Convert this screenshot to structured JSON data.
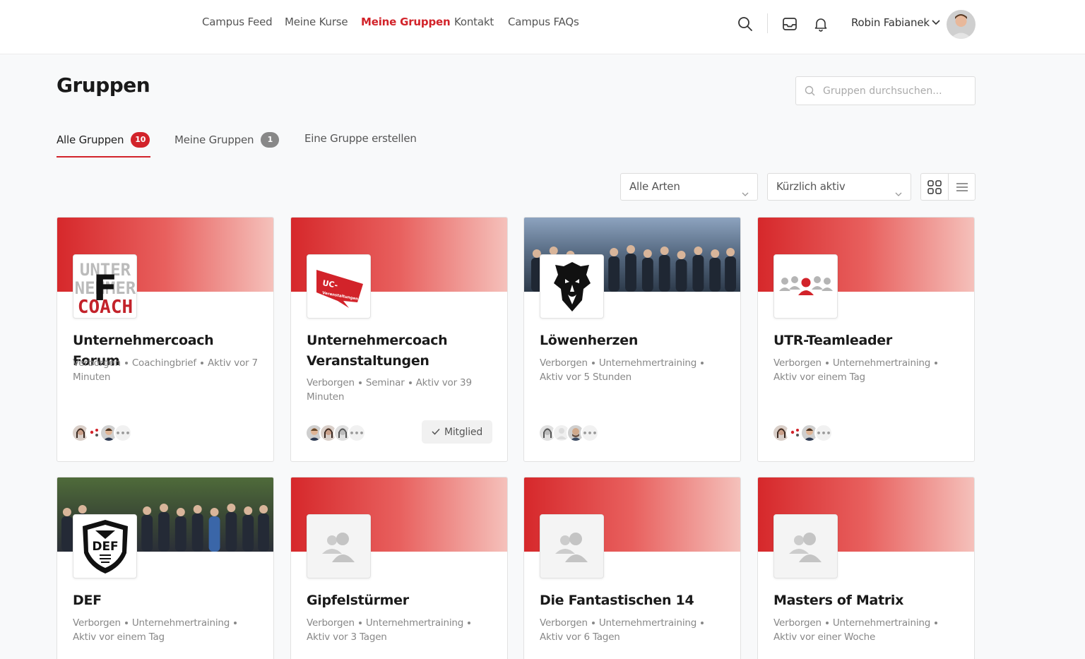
{
  "nav": {
    "items": [
      {
        "label": "Campus Feed"
      },
      {
        "label": "Meine Kurse"
      },
      {
        "label": "Meine Gruppen"
      },
      {
        "label": "Kontakt"
      },
      {
        "label": "Campus FAQs"
      }
    ],
    "active_index": 2
  },
  "user": {
    "name": "Robin Fabianek"
  },
  "page": {
    "title": "Gruppen"
  },
  "search": {
    "placeholder": "Gruppen durchsuchen..."
  },
  "tabs": [
    {
      "label": "Alle Gruppen",
      "count": "10",
      "badge_color": "#d2232a"
    },
    {
      "label": "Meine Gruppen",
      "count": "1",
      "badge_color": "#888888"
    },
    {
      "label": "Eine Gruppe erstellen"
    }
  ],
  "filters": {
    "type": "Alle Arten",
    "sort": "Kürzlich aktiv"
  },
  "accent_color": "#d2232a",
  "groups": [
    {
      "name": "Unternehmercoach Forum",
      "visibility": "Verborgen",
      "type": "Coachingbrief",
      "activity": "Aktiv vor 7 Minuten",
      "cover": "gradient",
      "logo": "unternehmer-coach-forum-logo",
      "logo_text": "UNTER NEHMER COACH F"
    },
    {
      "name": "Unternehmercoach Veranstaltungen",
      "visibility": "Verborgen",
      "type": "Seminar",
      "activity": "Aktiv vor 39 Minuten",
      "cover": "gradient",
      "logo": "uc-veranstaltungen-logo",
      "logo_text": "UC- Veranstaltungen",
      "member_label": "Mitglied"
    },
    {
      "name": "Löwenherzen",
      "visibility": "Verborgen",
      "type": "Unternehmertraining",
      "activity": "Aktiv vor 5 Stunden",
      "cover": "photo",
      "logo": "lion-logo"
    },
    {
      "name": "UTR-Teamleader",
      "visibility": "Verborgen",
      "type": "Unternehmertraining",
      "activity": "Aktiv vor einem Tag",
      "cover": "gradient",
      "logo": "team-group-icon"
    },
    {
      "name": "DEF",
      "visibility": "Verborgen",
      "type": "Unternehmertraining",
      "activity": "Aktiv vor einem Tag",
      "cover": "photo",
      "logo": "def-shield-logo",
      "logo_text": "DEF"
    },
    {
      "name": "Gipfelstürmer",
      "visibility": "Verborgen",
      "type": "Unternehmertraining",
      "activity": "Aktiv vor 3 Tagen",
      "cover": "gradient",
      "logo": "default-group-icon"
    },
    {
      "name": "Die Fantastischen 14",
      "visibility": "Verborgen",
      "type": "Unternehmertraining",
      "activity": "Aktiv vor 6 Tagen",
      "cover": "gradient",
      "logo": "default-group-icon"
    },
    {
      "name": "Masters of Matrix",
      "visibility": "Verborgen",
      "type": "Unternehmertraining",
      "activity": "Aktiv vor einer Woche",
      "cover": "gradient",
      "logo": "default-group-icon"
    }
  ],
  "members_more": "•••"
}
